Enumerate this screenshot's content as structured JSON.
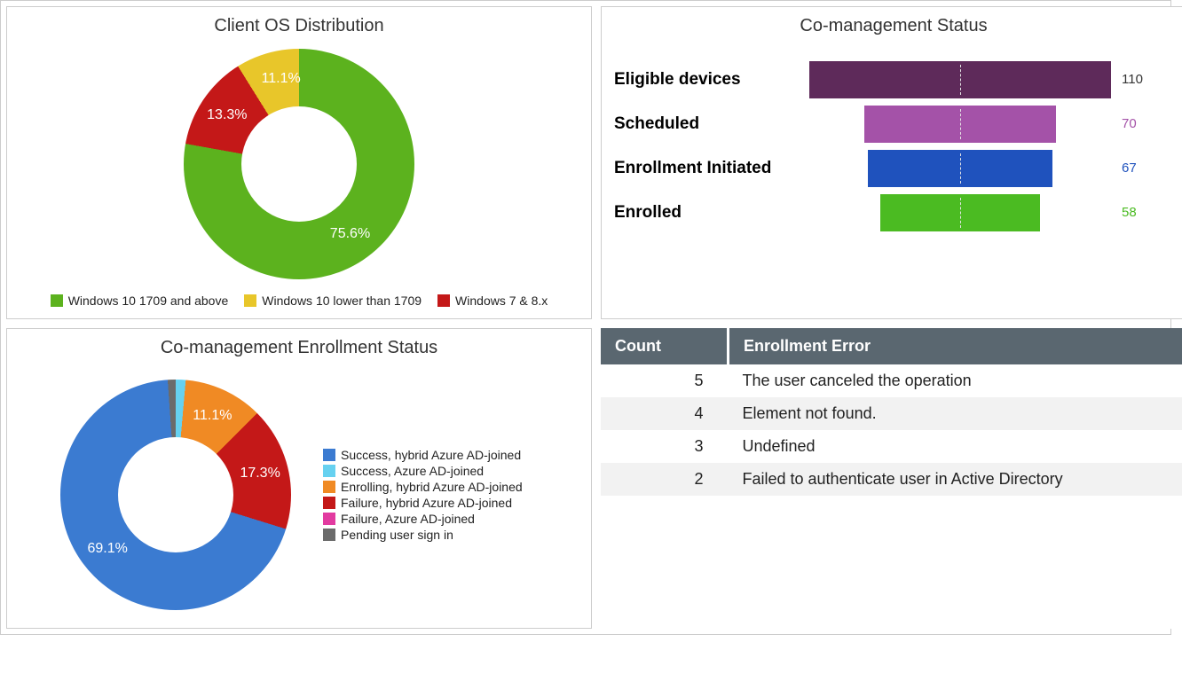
{
  "chart_data": [
    {
      "id": "client_os",
      "type": "pie",
      "title": "Client OS Distribution",
      "series": [
        {
          "name": "Windows 10 1709 and above",
          "value": 75.6,
          "pct_label": "75.6%",
          "color": "#5cb21e"
        },
        {
          "name": "Windows 10 lower than 1709",
          "value": 11.1,
          "pct_label": "11.1%",
          "color": "#e8c62a"
        },
        {
          "name": "Windows 7 & 8.x",
          "value": 13.3,
          "pct_label": "13.3%",
          "color": "#c41818"
        }
      ]
    },
    {
      "id": "comanagement_status",
      "type": "bar",
      "title": "Co-management Status",
      "xlim": [
        0,
        110
      ],
      "series": [
        {
          "name": "Eligible devices",
          "value": 110,
          "color": "#5e2a5a",
          "value_color": "#333"
        },
        {
          "name": "Scheduled",
          "value": 70,
          "color": "#a452a8",
          "value_color": "#a452a8"
        },
        {
          "name": "Enrollment Initiated",
          "value": 67,
          "color": "#1f52bd",
          "value_color": "#1f52bd"
        },
        {
          "name": "Enrolled",
          "value": 58,
          "color": "#4bbb22",
          "value_color": "#4bbb22"
        }
      ]
    },
    {
      "id": "enrollment_status",
      "type": "pie",
      "title": "Co-management Enrollment Status",
      "series": [
        {
          "name": "Success, hybrid Azure AD-joined",
          "value": 69.1,
          "pct_label": "69.1%",
          "color": "#3b7bd1"
        },
        {
          "name": "Success, Azure AD-joined",
          "value": 2.5,
          "pct_label": "",
          "color": "#66d1f0"
        },
        {
          "name": "Enrolling, hybrid Azure AD-joined",
          "value": 11.1,
          "pct_label": "11.1%",
          "color": "#f08a24"
        },
        {
          "name": "Failure, hybrid Azure AD-joined",
          "value": 17.3,
          "pct_label": "17.3%",
          "color": "#c41818"
        },
        {
          "name": "Failure, Azure AD-joined",
          "value": 0.0,
          "pct_label": "",
          "color": "#e23ba0"
        },
        {
          "name": "Pending user sign in",
          "value": 0.0,
          "pct_label": "",
          "color": "#6b6b6b"
        }
      ]
    },
    {
      "id": "error_table",
      "type": "table",
      "headers": {
        "count": "Count",
        "error": "Enrollment Error"
      },
      "rows": [
        {
          "count": 5,
          "error": "The user canceled the operation"
        },
        {
          "count": 4,
          "error": "Element not found."
        },
        {
          "count": 3,
          "error": "Undefined"
        },
        {
          "count": 2,
          "error": "Failed to authenticate user in Active Directory"
        }
      ]
    }
  ]
}
